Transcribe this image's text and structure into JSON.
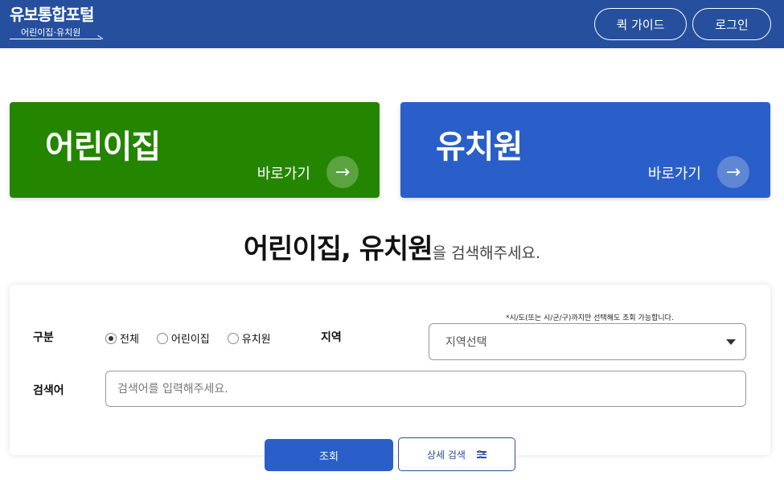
{
  "header": {
    "logo_title": "유보통합포털",
    "logo_sub": "어린이집·유치원",
    "guide_label": "퀵 가이드",
    "login_label": "로그인"
  },
  "cards": {
    "daycare": {
      "title": "어린이집",
      "link": "바로가기",
      "color": "#248500"
    },
    "kinder": {
      "title": "유치원",
      "link": "바로가기",
      "color": "#2a5fc9"
    }
  },
  "headline": {
    "strong": "어린이집, 유치원",
    "light": "을 검색해주세요."
  },
  "search": {
    "type_label": "구분",
    "type_options": [
      "전체",
      "어린이집",
      "유치원"
    ],
    "type_selected": "전체",
    "region_label": "지역",
    "region_note": "*시/도(또는 시/군/구)까지만 선택해도 조회 가능합니다.",
    "region_placeholder": "지역선택",
    "keyword_label": "검색어",
    "keyword_placeholder": "검색어를 입력해주세요.",
    "submit_label": "조회",
    "detail_label": "상세 검색"
  },
  "colors": {
    "header": "#26509e",
    "accent": "#2a5fc9"
  }
}
